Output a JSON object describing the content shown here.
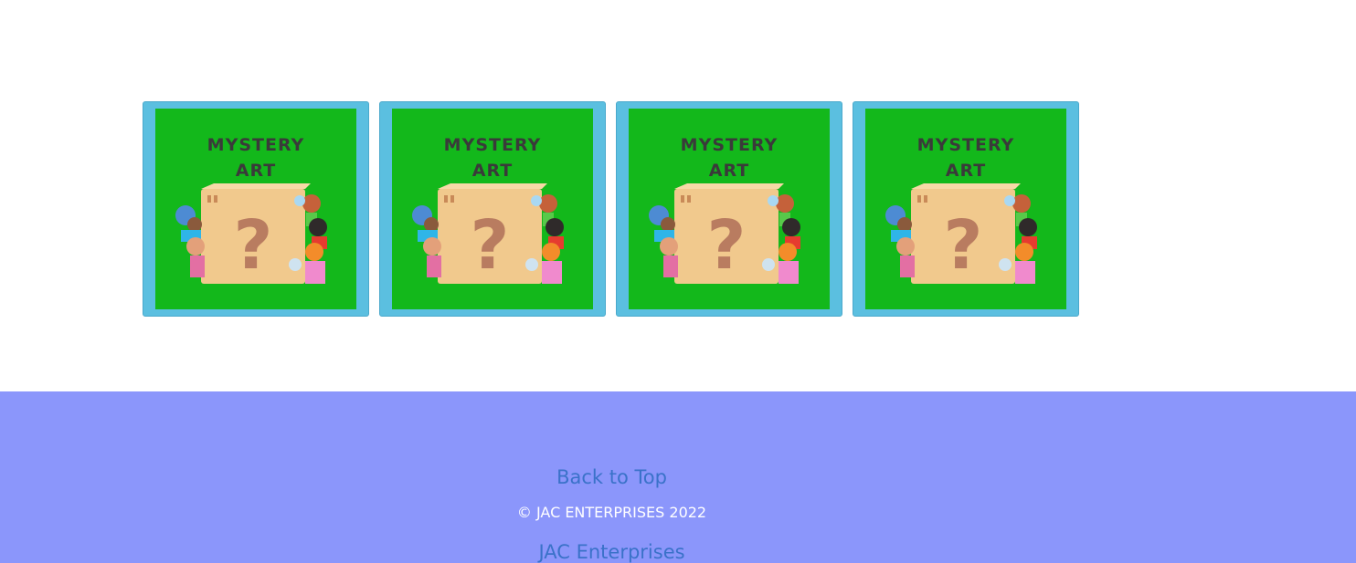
{
  "gallery": {
    "items": [
      {
        "line1": "MYSTERY",
        "line2": "ART"
      },
      {
        "line1": "MYSTERY",
        "line2": "ART"
      },
      {
        "line1": "MYSTERY",
        "line2": "ART"
      },
      {
        "line1": "MYSTERY",
        "line2": "ART"
      }
    ]
  },
  "footer": {
    "back_to_top": "Back to Top",
    "copyright": "© JAC ENTERPRISES 2022",
    "brand_link": "JAC Enterprises"
  },
  "colors": {
    "card_border": "#5bbfe0",
    "tile_green": "#13b81b",
    "footer_bg": "#8b96fb",
    "link": "#3a72c9"
  }
}
